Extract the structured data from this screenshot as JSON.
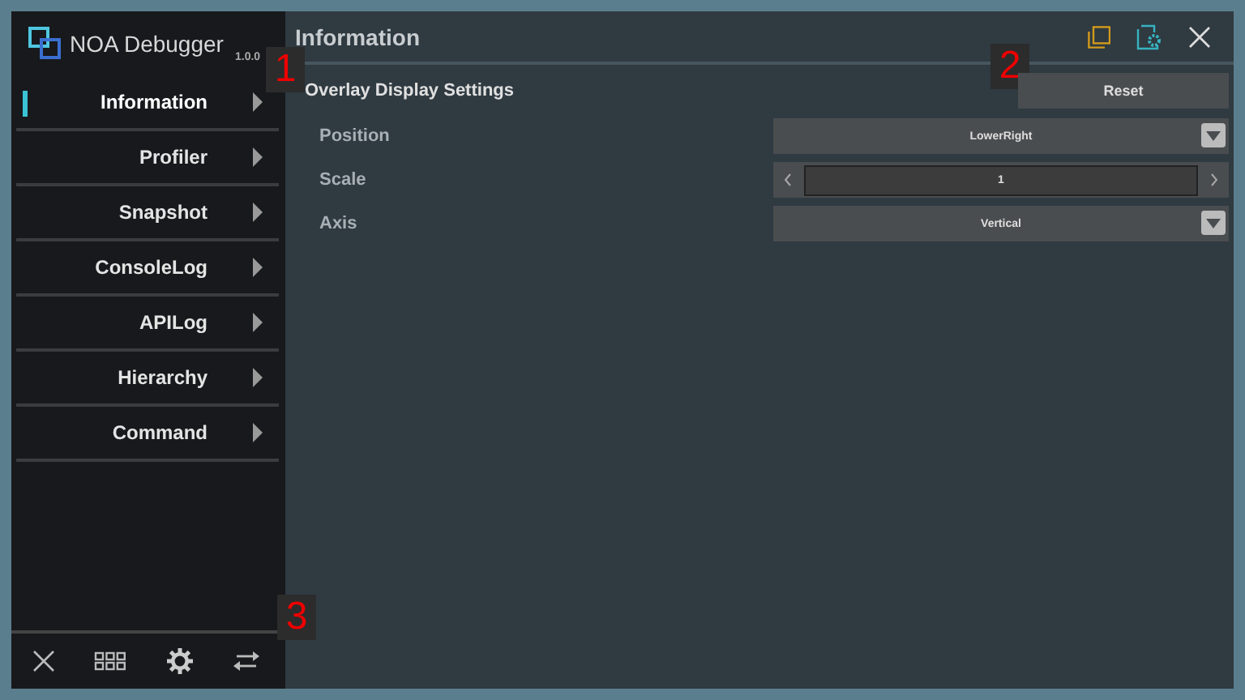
{
  "app": {
    "name": "NOA Debugger",
    "version": "1.0.0"
  },
  "sidebar": {
    "items": [
      {
        "label": "Information",
        "selected": true
      },
      {
        "label": "Profiler",
        "selected": false
      },
      {
        "label": "Snapshot",
        "selected": false
      },
      {
        "label": "ConsoleLog",
        "selected": false
      },
      {
        "label": "APILog",
        "selected": false
      },
      {
        "label": "Hierarchy",
        "selected": false
      },
      {
        "label": "Command",
        "selected": false
      }
    ]
  },
  "panel": {
    "title": "Information",
    "section": "Overlay Display Settings",
    "reset": "Reset",
    "settings": [
      {
        "kind": "dropdown",
        "label": "Position",
        "value": "LowerRight"
      },
      {
        "kind": "stepper",
        "label": "Scale",
        "value": "1"
      },
      {
        "kind": "dropdown",
        "label": "Axis",
        "value": "Vertical"
      }
    ]
  },
  "callouts": [
    "1",
    "2",
    "3"
  ]
}
